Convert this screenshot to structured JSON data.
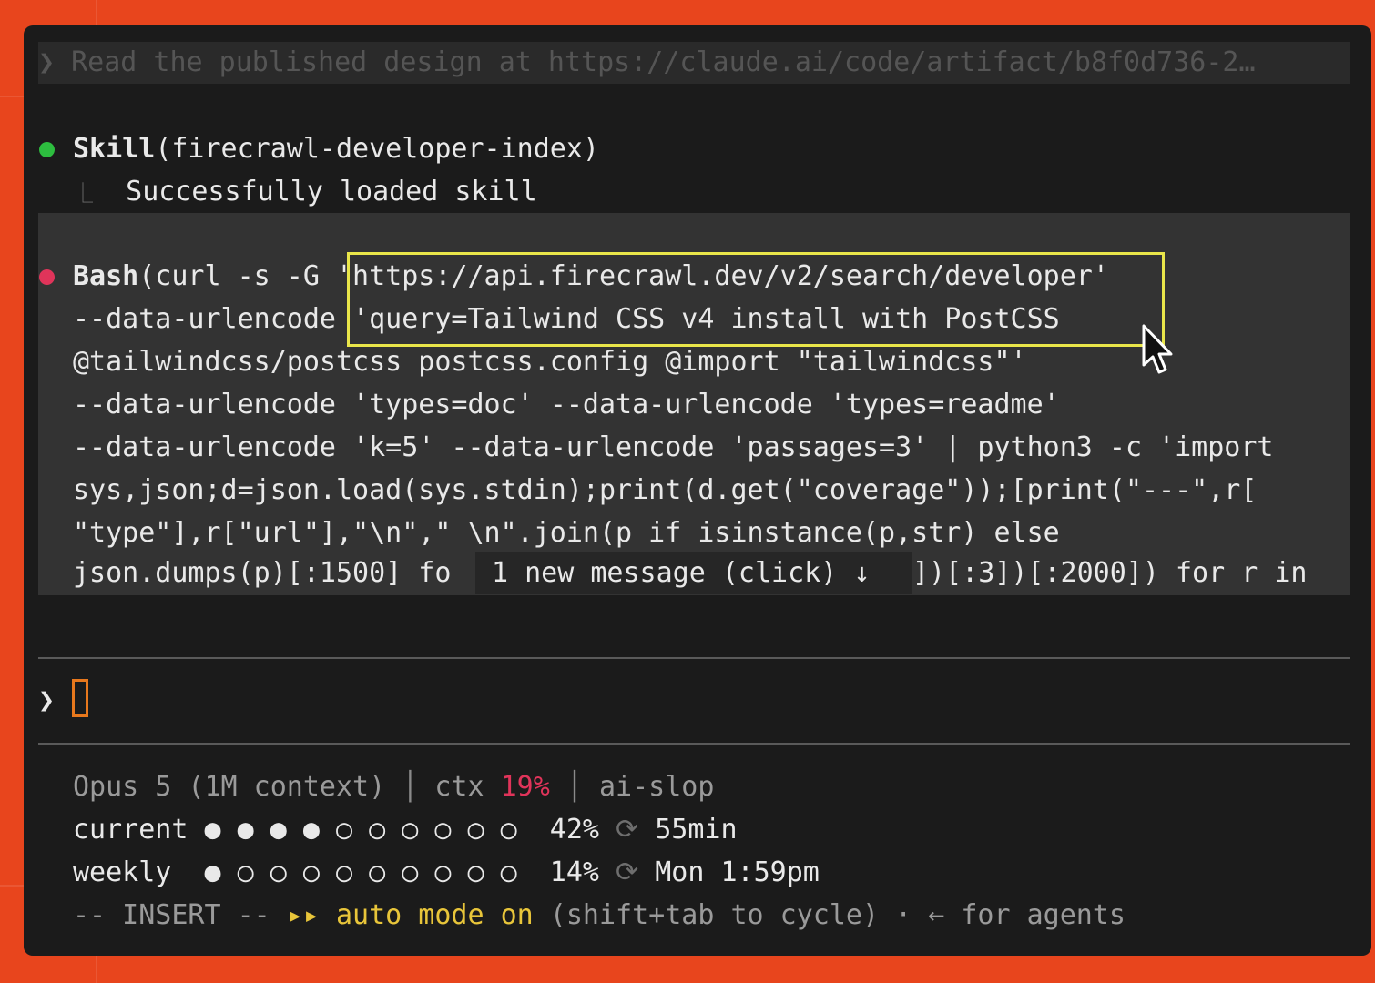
{
  "prompt_echo": "❯ Read the published design at https://claude.ai/code/artifact/b8f0d736-2…",
  "skill": {
    "name": "Skill",
    "args": "(firecrawl-developer-index)",
    "result_prefix": "⎿",
    "result": "Successfully loaded skill",
    "status_color": "#2dbd3f"
  },
  "bash": {
    "name": "Bash",
    "status_color": "#e0345a",
    "lines": [
      "(curl -s -G 'https://api.firecrawl.dev/v2/search/developer'",
      "--data-urlencode 'query=Tailwind CSS v4 install with PostCSS",
      "@tailwindcss/postcss postcss.config @import \"tailwindcss\"'",
      "--data-urlencode 'types=doc' --data-urlencode 'types=readme'",
      "--data-urlencode 'k=5' --data-urlencode 'passages=3' | python3 -c 'import",
      "sys,json;d=json.load(sys.stdin);print(d.get(\"coverage\"));[print(\"---\",r[",
      "\"type\"],r[\"url\"],\"\\n\",\" \\n\".join(p if isinstance(p,str) else",
      "json.dumps(p)[:1500] fo"
    ],
    "line8_tail": "])[:3])[:2000]) for r in",
    "toast": "1 new message (click) ↓"
  },
  "input": {
    "prompt_symbol": "❯",
    "value": ""
  },
  "status": {
    "model": "Opus 5 (1M context)",
    "ctx_label": "ctx",
    "ctx_value": "19%",
    "project": "ai-slop",
    "current_label": "current",
    "current_dots": "● ● ● ● ○ ○ ○ ○ ○ ○",
    "current_pct": "42%",
    "current_reset": "55min",
    "weekly_label": "weekly ",
    "weekly_dots": "● ○ ○ ○ ○ ○ ○ ○ ○ ○",
    "weekly_pct": "14%",
    "weekly_reset": "Mon 1:59pm",
    "reset_icon": "⟳",
    "mode_label": "-- INSERT --",
    "auto_icon": "▸▸",
    "auto_text": "auto mode on",
    "cycle_hint": "(shift+tab to cycle)",
    "agents_hint": "· ← for agents"
  }
}
